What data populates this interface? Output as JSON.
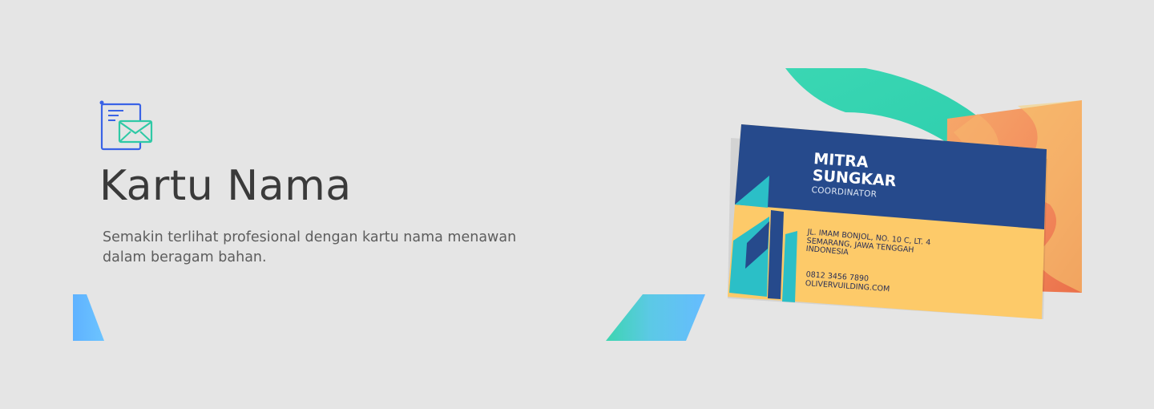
{
  "banner": {
    "title": "Kartu Nama",
    "subtitle_line1": "Semakin terlihat profesional dengan kartu nama menawan",
    "subtitle_line2": "dalam beragam bahan.",
    "icon": "document-envelope-icon"
  },
  "business_card": {
    "name_line1": "MITRA",
    "name_line2": "SUNGKAR",
    "role": "COORDINATOR",
    "address_line1": "JL. IMAM BONJOL, NO. 10 C, LT. 4",
    "address_line2": "SEMARANG, JAWA TENGGAH",
    "address_line3": "INDONESIA",
    "phone": "0812 3456 7890",
    "website": "OLIVERVUILDING.COM"
  },
  "colors": {
    "background": "#e5e5e5",
    "accent_blue": "#66bcff",
    "accent_teal": "#37d6b2",
    "card_navy": "#264a8c",
    "card_yellow": "#fcc96a"
  }
}
